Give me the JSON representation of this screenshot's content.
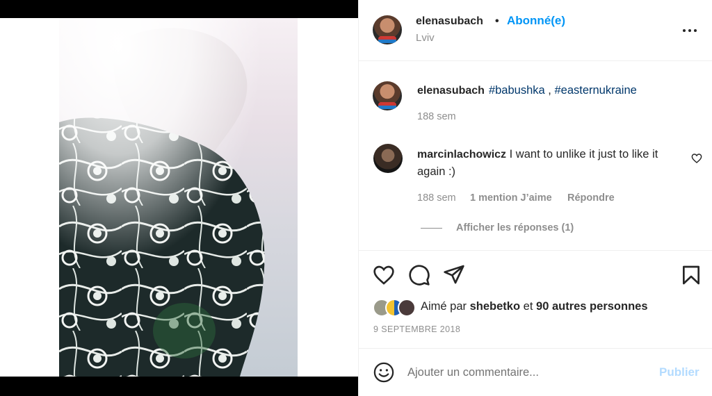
{
  "post": {
    "username": "elenasubach",
    "separator": "•",
    "follow_label": "Abonné(e)",
    "location": "Lviv"
  },
  "caption": {
    "username": "elenasubach",
    "tag1": "#babushka",
    "sep": ",",
    "tag2": "#easternukraine",
    "time": "188 sem"
  },
  "comment": {
    "username": "marcinlachowicz",
    "text": "I want to unlike it just to like it again :)",
    "time": "188 sem",
    "likes": "1 mention J’aime",
    "reply": "Répondre",
    "view_replies": "Afficher les réponses (1)"
  },
  "likes": {
    "prefix": "Aimé par",
    "user": "shebetko",
    "conj": "et",
    "others": "90 autres personnes"
  },
  "date": "9 SEPTEMBRE 2018",
  "composer": {
    "placeholder": "Ajouter un commentaire...",
    "publish_label": "Publier"
  },
  "icons": {
    "more": "more-options-icon",
    "like": "heart-icon",
    "comment": "comment-icon",
    "share": "send-icon",
    "save": "bookmark-icon",
    "emoji": "emoji-icon"
  },
  "colors": {
    "accent": "#0095f6",
    "hashtag": "#00376b",
    "muted": "#8e8e8e",
    "publish_disabled": "#b3dbff"
  }
}
